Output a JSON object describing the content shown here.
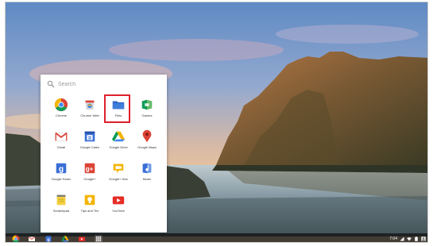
{
  "launcher": {
    "search_placeholder": "Search",
    "apps": [
      {
        "label": "Chrome",
        "icon": "chrome-icon"
      },
      {
        "label": "Chrome Web",
        "icon": "chrome-web-store-icon"
      },
      {
        "label": "Files",
        "icon": "files-folder-icon"
      },
      {
        "label": "Games",
        "icon": "games-icon"
      },
      {
        "label": "Gmail",
        "icon": "gmail-icon"
      },
      {
        "label": "Google Calen",
        "icon": "google-calendar-icon"
      },
      {
        "label": "Google Drive",
        "icon": "google-drive-icon"
      },
      {
        "label": "Google Maps",
        "icon": "google-maps-icon"
      },
      {
        "label": "Google Searc",
        "icon": "google-search-icon"
      },
      {
        "label": "Google+",
        "icon": "google-plus-icon"
      },
      {
        "label": "Google+ Han",
        "icon": "google-hangouts-icon"
      },
      {
        "label": "Music",
        "icon": "music-icon"
      },
      {
        "label": "Scratchpad",
        "icon": "scratchpad-icon"
      },
      {
        "label": "Tips and Tric",
        "icon": "tips-icon"
      },
      {
        "label": "YouTube",
        "icon": "youtube-icon"
      }
    ],
    "highlighted_app": "Files"
  },
  "shelf": {
    "pinned_apps": [
      "chrome-icon",
      "gmail-icon",
      "google-search-icon",
      "google-drive-icon",
      "youtube-icon",
      "app-launcher-icon"
    ],
    "status": {
      "time": "7:04",
      "icons": [
        "network-icon",
        "wifi-icon",
        "battery-icon",
        "avatar-icon"
      ]
    }
  },
  "colors": {
    "highlight": "#e0202b",
    "folder_blue": "#3f7ddb"
  }
}
